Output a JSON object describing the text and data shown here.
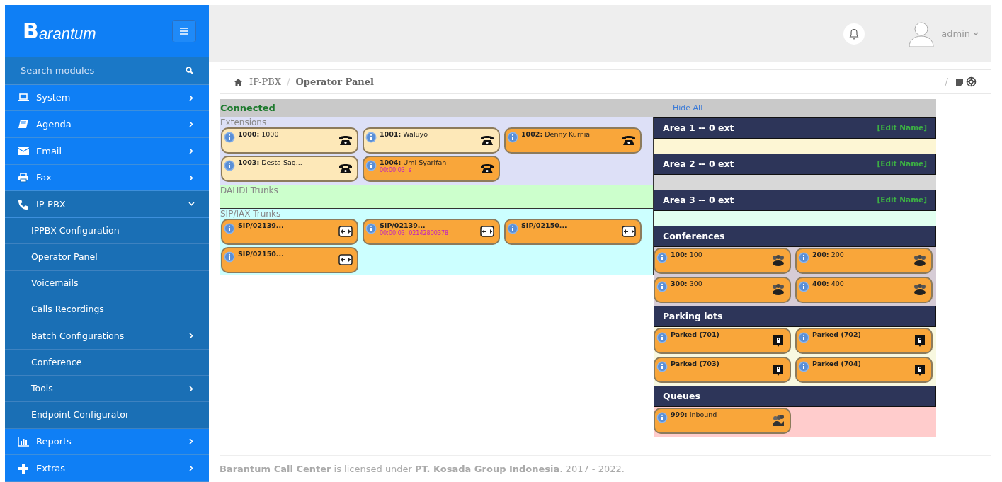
{
  "sidebar": {
    "logo_mark": "B",
    "logo_text": "arantum",
    "search_placeholder": "Search modules",
    "items": [
      {
        "label": "System",
        "expanded": false
      },
      {
        "label": "Agenda",
        "expanded": false
      },
      {
        "label": "Email",
        "expanded": false
      },
      {
        "label": "Fax",
        "expanded": false
      },
      {
        "label": "IP-PBX",
        "expanded": true,
        "children": [
          {
            "label": "IPPBX Configuration",
            "has_submenu": false
          },
          {
            "label": "Operator Panel",
            "has_submenu": false
          },
          {
            "label": "Voicemails",
            "has_submenu": false
          },
          {
            "label": "Calls Recordings",
            "has_submenu": false
          },
          {
            "label": "Batch Configurations",
            "has_submenu": true
          },
          {
            "label": "Conference",
            "has_submenu": false
          },
          {
            "label": "Tools",
            "has_submenu": true
          },
          {
            "label": "Endpoint Configurator",
            "has_submenu": false
          }
        ]
      },
      {
        "label": "Reports",
        "expanded": false
      },
      {
        "label": "Extras",
        "expanded": false
      }
    ]
  },
  "header": {
    "user": "admin"
  },
  "breadcrumb": {
    "items": [
      "IP-PBX",
      "Operator Panel"
    ],
    "separator_right": "/"
  },
  "panel": {
    "status": "Connected",
    "hide_all": "Hide All",
    "left_sections": [
      {
        "title": "Extensions",
        "items": [
          {
            "kind": "extension",
            "label": "**1000:** 1000",
            "busy": false
          },
          {
            "kind": "extension",
            "label": "**1001:** Waluyo",
            "busy": false
          },
          {
            "kind": "extension",
            "label": "**1002:** Denny Kurnia",
            "busy": true
          },
          {
            "kind": "extension",
            "label": "**1003:** Desta Sag...",
            "busy": false
          },
          {
            "kind": "extension",
            "label": "**1004:** Umi Syarifah",
            "busy": true,
            "detail": "00:00:03: s"
          }
        ]
      },
      {
        "title": "DAHDI Trunks"
      },
      {
        "title": "SIP/IAX Trunks",
        "items": [
          {
            "kind": "trunk",
            "label": "SIP/02139...",
            "busy": true
          },
          {
            "kind": "trunk",
            "label": "SIP/02139...",
            "busy": true,
            "detail": "00:00:03: 02142800378"
          },
          {
            "kind": "trunk",
            "label": "SIP/02150...",
            "busy": true
          },
          {
            "kind": "trunk",
            "label": "SIP/02150...",
            "busy": true
          }
        ]
      }
    ],
    "areas": [
      {
        "title": "Area 1 -- 0 ext",
        "edit": "[Edit Name]"
      },
      {
        "title": "Area 2 -- 0 ext",
        "edit": "[Edit Name]"
      },
      {
        "title": "Area 3 -- 0 ext",
        "edit": "[Edit Name]"
      }
    ],
    "groups": [
      {
        "title": "Conferences",
        "items": [
          {
            "kind": "conference",
            "label": "**100:** 100",
            "busy": true
          },
          {
            "kind": "conference",
            "label": "**200:** 200",
            "busy": true
          },
          {
            "kind": "conference",
            "label": "**300:** 300",
            "busy": true
          },
          {
            "kind": "conference",
            "label": "**400:** 400",
            "busy": true
          }
        ]
      },
      {
        "title": "Parking lots",
        "items": [
          {
            "kind": "parking",
            "label": "Parked (701)",
            "busy": true
          },
          {
            "kind": "parking",
            "label": "Parked (702)",
            "busy": true
          },
          {
            "kind": "parking",
            "label": "Parked (703)",
            "busy": true
          },
          {
            "kind": "parking",
            "label": "Parked (704)",
            "busy": true
          }
        ]
      },
      {
        "title": "Queues",
        "items": [
          {
            "kind": "queue",
            "label": "**999:** Inbound",
            "busy": true
          }
        ]
      }
    ]
  },
  "footer": "**Barantum Call Center** is licensed under **PT. Kosada Group Indonesia**. 2017 - 2022."
}
